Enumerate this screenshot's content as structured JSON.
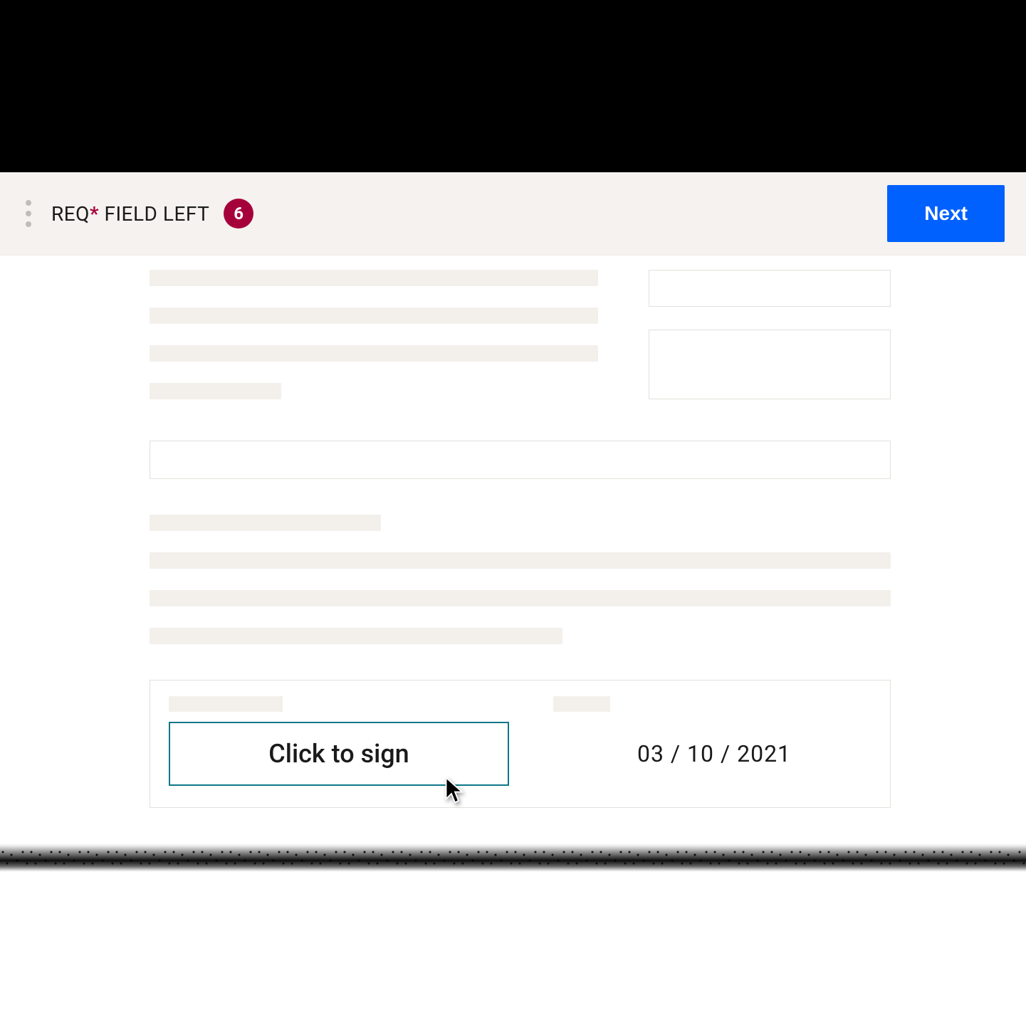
{
  "header": {
    "req_label_prefix": "REQ",
    "req_label_asterisk": "*",
    "req_label_suffix": " FIELD LEFT",
    "badge_count": "6",
    "next_button_label": "Next"
  },
  "signature": {
    "sign_button_label": "Click to sign",
    "date_value": "03 / 10 / 2021"
  },
  "colors": {
    "header_bg": "#f5f2ef",
    "accent_red": "#a6003b",
    "accent_blue": "#0061fe",
    "sign_border": "#0d7788",
    "placeholder": "#f3f0ec"
  }
}
